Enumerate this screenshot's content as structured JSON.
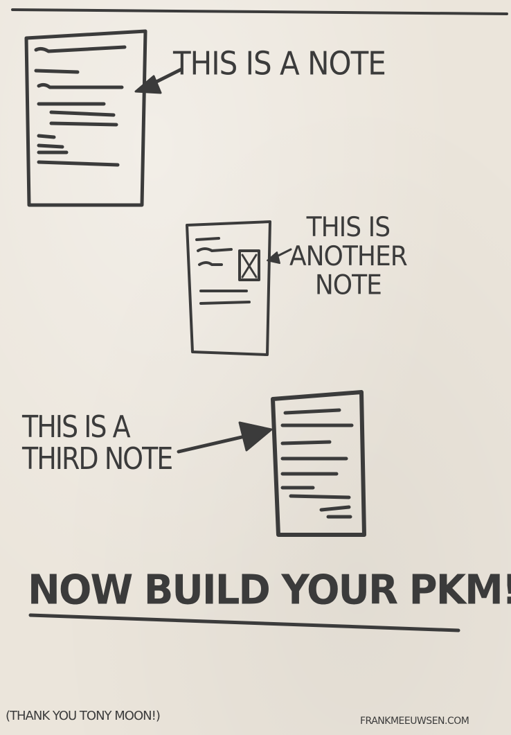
{
  "note_1": {
    "label": "THIS IS A NOTE"
  },
  "note_2": {
    "label_lines": [
      "THIS IS",
      "ANOTHER",
      "NOTE"
    ]
  },
  "note_3": {
    "label_lines": [
      "THIS IS A",
      "THIRD NOTE"
    ]
  },
  "headline": "NOW BUILD YOUR PKM!",
  "credits": {
    "thanks": "(THANK YOU TONY MOON!)",
    "site": "FRANKMEEUWSEN.COM"
  },
  "colors": {
    "ink": "#3b3b3b",
    "paper": "#ebe5db"
  }
}
